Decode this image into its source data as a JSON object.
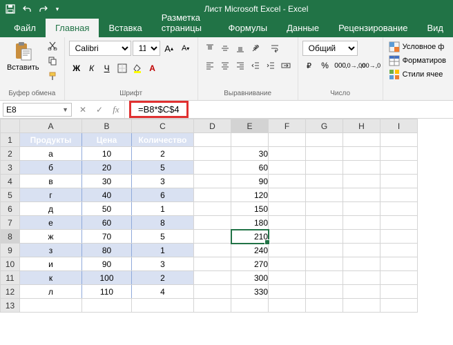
{
  "title": "Лист Microsoft Excel - Excel",
  "tabs": {
    "file": "Файл",
    "home": "Главная",
    "insert": "Вставка",
    "layout": "Разметка страницы",
    "formulas": "Формулы",
    "data": "Данные",
    "review": "Рецензирование",
    "view": "Вид"
  },
  "ribbon": {
    "paste": "Вставить",
    "clipboard": "Буфер обмена",
    "font_group": "Шрифт",
    "alignment": "Выравнивание",
    "number": "Число",
    "font_name": "Calibri",
    "font_size": "11",
    "number_format": "Общий",
    "cond_format": "Условное ф",
    "format_table": "Форматиров",
    "cell_styles": "Стили ячее"
  },
  "namebox": "E8",
  "formula": "=B8*$C$4",
  "headers": {
    "A": "Продукты",
    "B": "Цена",
    "C": "Количество"
  },
  "rows": [
    {
      "a": "а",
      "b": "10",
      "c": "2",
      "e": "30"
    },
    {
      "a": "б",
      "b": "20",
      "c": "5",
      "e": "60"
    },
    {
      "a": "в",
      "b": "30",
      "c": "3",
      "e": "90"
    },
    {
      "a": "г",
      "b": "40",
      "c": "6",
      "e": "120"
    },
    {
      "a": "д",
      "b": "50",
      "c": "1",
      "e": "150"
    },
    {
      "a": "е",
      "b": "60",
      "c": "8",
      "e": "180"
    },
    {
      "a": "ж",
      "b": "70",
      "c": "5",
      "e": "210"
    },
    {
      "a": "з",
      "b": "80",
      "c": "1",
      "e": "240"
    },
    {
      "a": "и",
      "b": "90",
      "c": "3",
      "e": "270"
    },
    {
      "a": "к",
      "b": "100",
      "c": "2",
      "e": "300"
    },
    {
      "a": "л",
      "b": "110",
      "c": "4",
      "e": "330"
    }
  ],
  "columns": [
    "A",
    "B",
    "C",
    "D",
    "E",
    "F",
    "G",
    "H",
    "I"
  ],
  "active_cell": {
    "row": 8,
    "col": "E"
  }
}
